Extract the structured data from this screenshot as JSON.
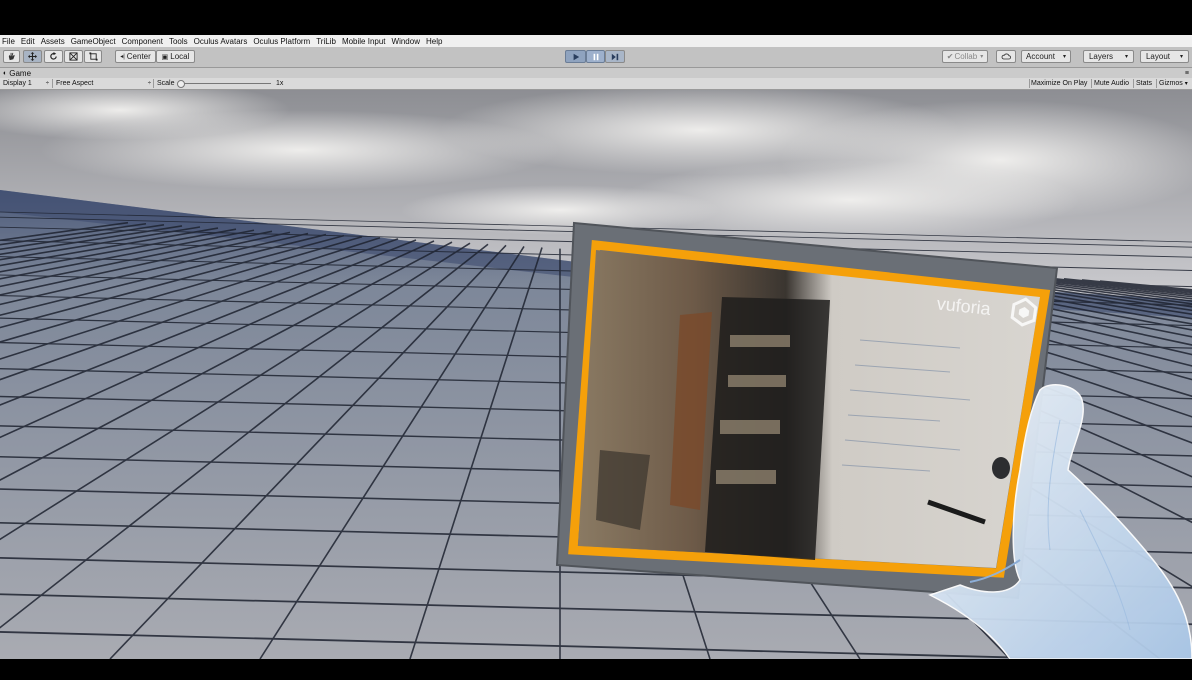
{
  "menu": [
    "File",
    "Edit",
    "Assets",
    "GameObject",
    "Component",
    "Tools",
    "Oculus Avatars",
    "Oculus Platform",
    "TriLib",
    "Mobile Input",
    "Window",
    "Help"
  ],
  "toolbar": {
    "tools": [
      "hand-icon",
      "move-icon",
      "rotate-icon",
      "scale-icon",
      "rect-icon"
    ],
    "pivot_label": "Center",
    "space_label": "Local",
    "collab_label": "Collab",
    "account_label": "Account",
    "layers_label": "Layers",
    "layout_label": "Layout"
  },
  "game_view": {
    "tab_label": "Game",
    "display_label": "Display 1",
    "aspect_label": "Free Aspect",
    "scale_label": "Scale",
    "scale_value": "1x",
    "maximize_label": "Maximize On Play",
    "mute_label": "Mute Audio",
    "stats_label": "Stats",
    "gizmos_label": "Gizmos"
  },
  "scene": {
    "panel_logo_text": "vuforia",
    "frame_color": "#f5a00a",
    "panel_color": "#6a6f76"
  }
}
